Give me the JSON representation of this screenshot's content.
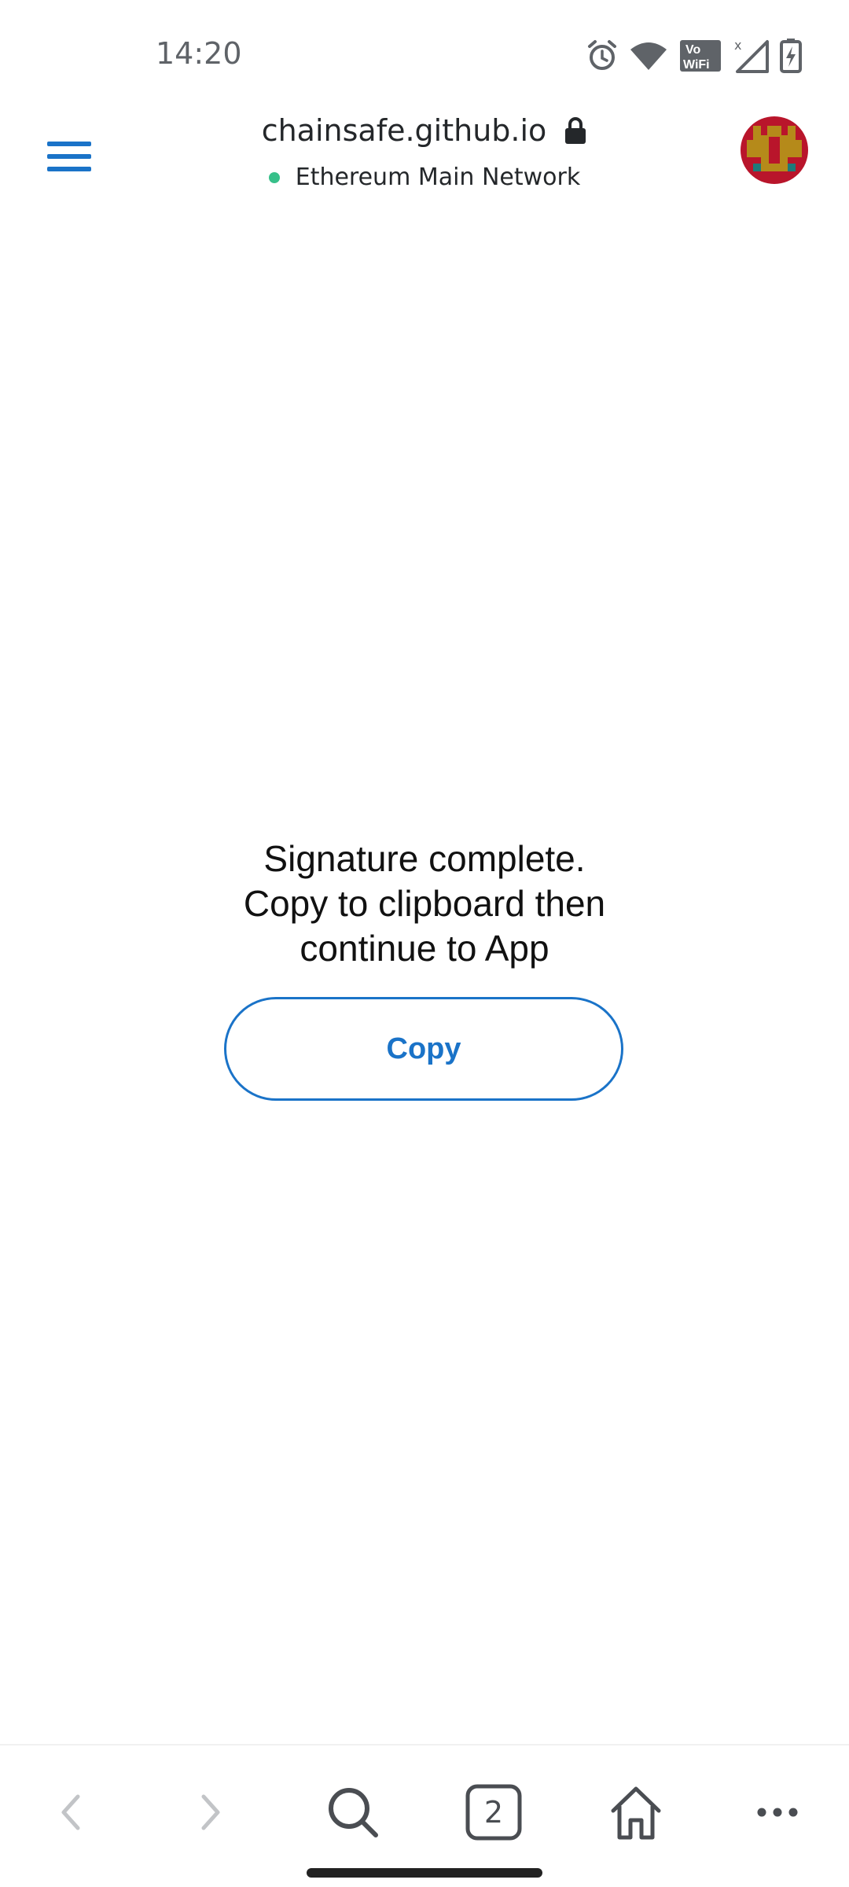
{
  "status_bar": {
    "time": "14:20",
    "icons": [
      "alarm-icon",
      "wifi-icon",
      "vowifi-icon",
      "signal-icon",
      "battery-charging-icon"
    ],
    "vowifi_label_top": "Vo",
    "vowifi_label_bottom": "WiFi"
  },
  "header": {
    "url": "chainsafe.github.io",
    "network": "Ethereum Main Network",
    "accent_color": "#1a73c8",
    "network_dot_color": "#37c08a"
  },
  "content": {
    "message": "Signature complete.\nCopy to clipboard then\ncontinue to App",
    "copy_label": "Copy"
  },
  "bottom_nav": {
    "tabs_count": "2",
    "buttons": [
      "back-icon",
      "forward-icon",
      "search-icon",
      "tabs-icon",
      "home-icon",
      "more-icon"
    ]
  }
}
